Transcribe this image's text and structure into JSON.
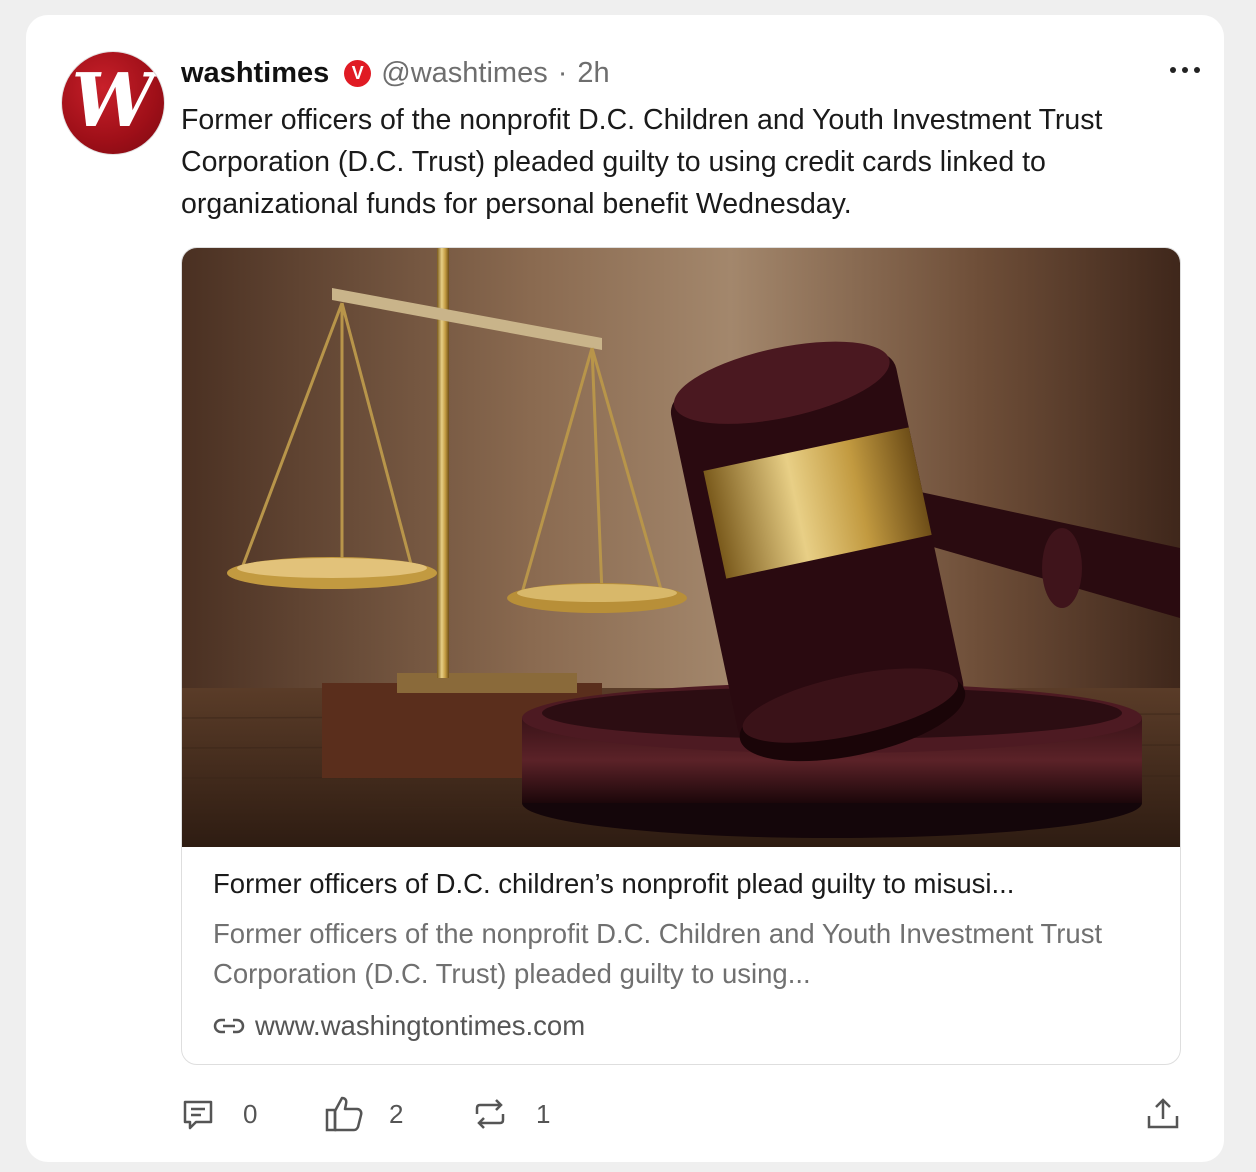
{
  "post": {
    "username": "washtimes",
    "handle": "@washtimes",
    "separator": "·",
    "time": "2h",
    "avatar_letter": "W",
    "verified_letter": "V",
    "text": "Former officers of the nonprofit D.C. Children and Youth Investment Trust Corporation (D.C. Trust) pleaded guilty to using credit cards linked to organizational funds for personal benefit Wednesday.",
    "brand_color": "#e01b24"
  },
  "link_preview": {
    "title": "Former officers of D.C. children’s nonprofit plead guilty to misusi...",
    "description": "Former officers of the nonprofit D.C. Children and Youth Investment Trust Corporation (D.C. Trust) pleaded guilty to using...",
    "domain": "www.washingtontimes.com",
    "domain_icon": "link-icon",
    "image_subject": "scales of justice and wooden gavel"
  },
  "actions": {
    "comments": {
      "icon": "comment-icon",
      "count": "0"
    },
    "likes": {
      "icon": "thumbs-up-icon",
      "count": "2"
    },
    "reposts": {
      "icon": "repost-icon",
      "count": "1"
    },
    "share": {
      "icon": "share-icon"
    }
  }
}
